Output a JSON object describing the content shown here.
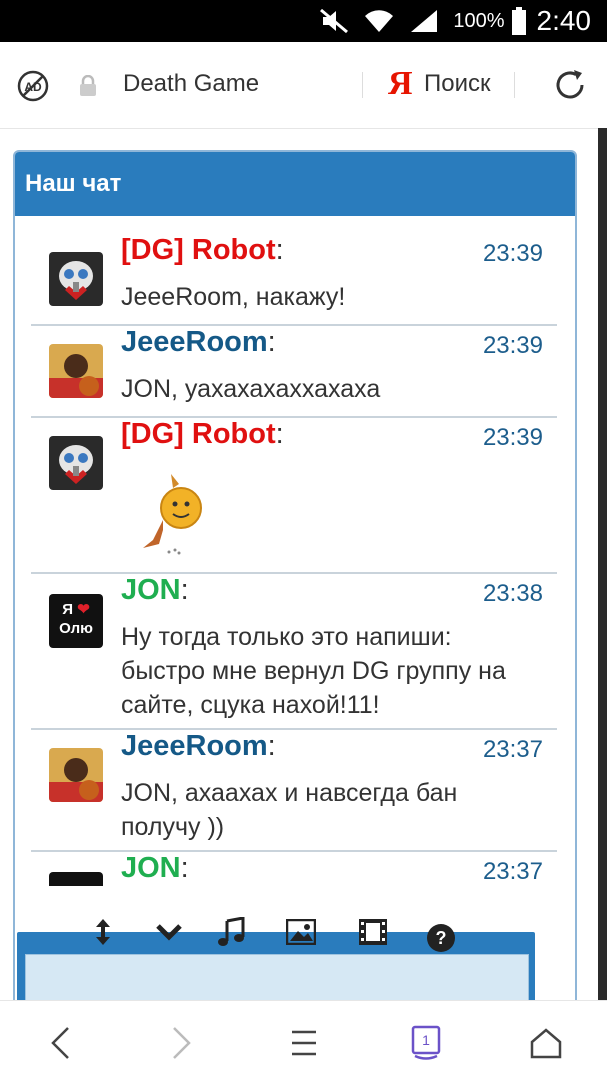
{
  "status": {
    "battery": "100%",
    "time": "2:40"
  },
  "browser": {
    "site_title": "Death Game",
    "search_label": "Поиск",
    "yandex_logo": "Я",
    "tabs_count": "1"
  },
  "chat": {
    "title": "Наш чат",
    "messages": [
      {
        "author": "[DG] Robot",
        "colon": ":",
        "time": "23:39",
        "text": "JeeeRoom, накажу!",
        "author_color": "#e01010"
      },
      {
        "author": "JeeeRoom",
        "colon": ":",
        "time": "23:39",
        "text": "JON, уахахахаххахаха",
        "author_color": "#155987"
      },
      {
        "author": "[DG] Robot",
        "colon": ":",
        "time": "23:39",
        "text": "",
        "author_color": "#e01010"
      },
      {
        "author": "JON",
        "colon": ":",
        "time": "23:38",
        "text": "Ну тогда только это напиши: быстро мне вернул DG группу на сайте, сцука нахой!11!",
        "author_color": "#1fae50"
      },
      {
        "author": "JeeeRoom",
        "colon": ":",
        "time": "23:37",
        "text": "JON, ахаахах и навсегда бан получу ))",
        "author_color": "#155987"
      },
      {
        "author": "JON",
        "colon": ":",
        "time": "23:37",
        "text": "",
        "author_color": "#1fae50"
      }
    ],
    "jon_avatar": {
      "line1": "Я",
      "line2": "Олю"
    }
  },
  "icons": {
    "toolbar": [
      "resize-icon",
      "chevron-down-icon",
      "music-icon",
      "image-icon",
      "video-icon",
      "help-icon"
    ],
    "bottom_nav": [
      "back-icon",
      "forward-icon",
      "menu-icon",
      "tabs-icon",
      "home-icon"
    ]
  }
}
